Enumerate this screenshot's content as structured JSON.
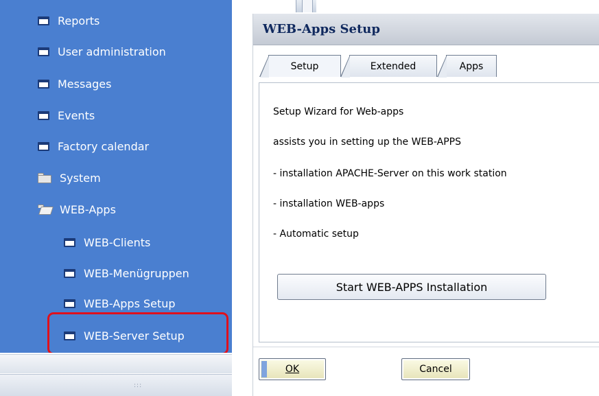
{
  "sidebar": {
    "items": [
      {
        "label": "Reports",
        "icon": "window-icon"
      },
      {
        "label": "User administration",
        "icon": "window-icon"
      },
      {
        "label": "Messages",
        "icon": "window-icon"
      },
      {
        "label": "Events",
        "icon": "window-icon"
      },
      {
        "label": "Factory calendar",
        "icon": "window-icon"
      },
      {
        "label": "System",
        "icon": "folder-icon"
      },
      {
        "label": "WEB-Apps",
        "icon": "folder-open-icon"
      },
      {
        "label": "WEB-Clients",
        "icon": "window-icon"
      },
      {
        "label": "WEB-Menügruppen",
        "icon": "window-icon"
      },
      {
        "label": "WEB-Apps Setup",
        "icon": "window-icon"
      },
      {
        "label": "WEB-Server Setup",
        "icon": "window-icon",
        "highlighted": true
      }
    ],
    "grip": ":::"
  },
  "dialog": {
    "title": "WEB-Apps Setup",
    "tabs": [
      {
        "label": "Setup",
        "active": true
      },
      {
        "label": "Extended",
        "active": false
      },
      {
        "label": "Apps",
        "active": false
      }
    ],
    "lines": [
      "Setup Wizard for Web-apps",
      "assists you in setting up the WEB-APPS",
      "- installation APACHE-Server on this work station",
      "- installation WEB-apps",
      "- Automatic setup"
    ],
    "install_button": "Start WEB-APPS Installation",
    "ok_button": "OK",
    "cancel_button": "Cancel"
  },
  "colors": {
    "sidebar_bg": "#4a7fd0",
    "highlight": "#e0101c",
    "title_text": "#10295e"
  }
}
